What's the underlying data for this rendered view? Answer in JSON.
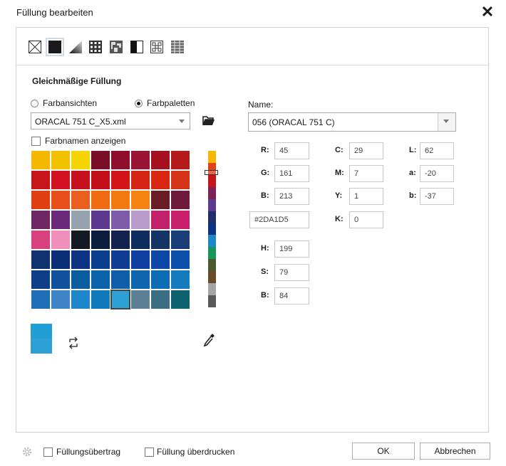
{
  "window": {
    "title": "Füllung bearbeiten",
    "close_icon": "close-icon"
  },
  "toolbar": {
    "icons": [
      "no-fill-icon",
      "uniform-fill-icon",
      "fountain-fill-icon",
      "vector-pattern-icon",
      "bitmap-pattern-icon",
      "two-color-pattern-icon",
      "texture-fill-icon",
      "postscript-fill-icon"
    ],
    "selected": "uniform-fill-icon"
  },
  "section_title": "Gleichmäßige Füllung",
  "mode": {
    "options": [
      "Farbansichten",
      "Farbpaletten"
    ],
    "selected": "Farbpaletten"
  },
  "palette": {
    "selected": "ORACAL 751 C_X5.xml"
  },
  "show_names_label": "Farbnamen anzeigen",
  "name": {
    "label": "Name:",
    "value": "056 (ORACAL 751 C)"
  },
  "rgb": {
    "r_label": "R:",
    "r": "45",
    "g_label": "G:",
    "g": "161",
    "b_label": "B:",
    "b": "213",
    "hex": "#2DA1D5"
  },
  "cmyk": {
    "c_label": "C:",
    "c": "29",
    "m_label": "M:",
    "m": "7",
    "y_label": "Y:",
    "y": "1",
    "k_label": "K:",
    "k": "0"
  },
  "lab": {
    "l_label": "L:",
    "l": "62",
    "a_label": "a:",
    "a": "-20",
    "b_label": "b:",
    "b": "-37"
  },
  "hsb": {
    "h_label": "H:",
    "h": "199",
    "s_label": "S:",
    "s": "79",
    "b_label": "B:",
    "b": "84"
  },
  "swatch": {
    "old_color": "#1F9FD6",
    "new_color": "#2DA1D5"
  },
  "footer": {
    "transfer_label": "Füllungsübertrag",
    "overprint_label": "Füllung überdrucken",
    "ok_label": "OK",
    "cancel_label": "Abbrechen"
  },
  "colors": {
    "grid_rows": [
      [
        "#F5B800",
        "#F2C200",
        "#F6D400",
        "#7A1027",
        "#8E0E2C",
        "#9A1434",
        "#A60F1F",
        "#B51A1A"
      ],
      [
        "#C8141B",
        "#D31321",
        "#C6101E",
        "#C2101A",
        "#D11519",
        "#D32414",
        "#DA2712",
        "#D43317"
      ],
      [
        "#E03F12",
        "#E7501A",
        "#EB5F1E",
        "#F06B12",
        "#F27A10",
        "#F48412",
        "#6A1C24",
        "#6E1A3C"
      ],
      [
        "#6E2762",
        "#6E2A7A",
        "#96A3AE",
        "#5D3A8E",
        "#7E5CA8",
        "#B99CCA",
        "#C2206A",
        "#C9206E"
      ],
      [
        "#D8407E",
        "#F08FB9",
        "#141A24",
        "#0C1D3E",
        "#13224F",
        "#0E2D5E",
        "#143466",
        "#1A3E78"
      ],
      [
        "#10326E",
        "#0A2F76",
        "#0D3483",
        "#0C3F8E",
        "#103C93",
        "#0F3EA0",
        "#0D48A7",
        "#0E51AD"
      ],
      [
        "#0E3E88",
        "#12529C",
        "#0A5D9F",
        "#0B63A9",
        "#105EA9",
        "#1065AF",
        "#0C6DB2",
        "#137BBE"
      ],
      [
        "#1E6FB6",
        "#3F86C8",
        "#1E87C9",
        "#0E7ABB",
        "#2DA1D5",
        "#5E8096",
        "#3B6E84",
        "#0E6270"
      ]
    ],
    "strip": [
      "#F5B800",
      "#E3411B",
      "#C5141A",
      "#7D2056",
      "#5A3B8E",
      "#22306A",
      "#0D3483",
      "#1E87C9",
      "#17955A",
      "#4C5B2E",
      "#6B4A2A",
      "#A5A5A5",
      "#5A5A5A"
    ]
  }
}
